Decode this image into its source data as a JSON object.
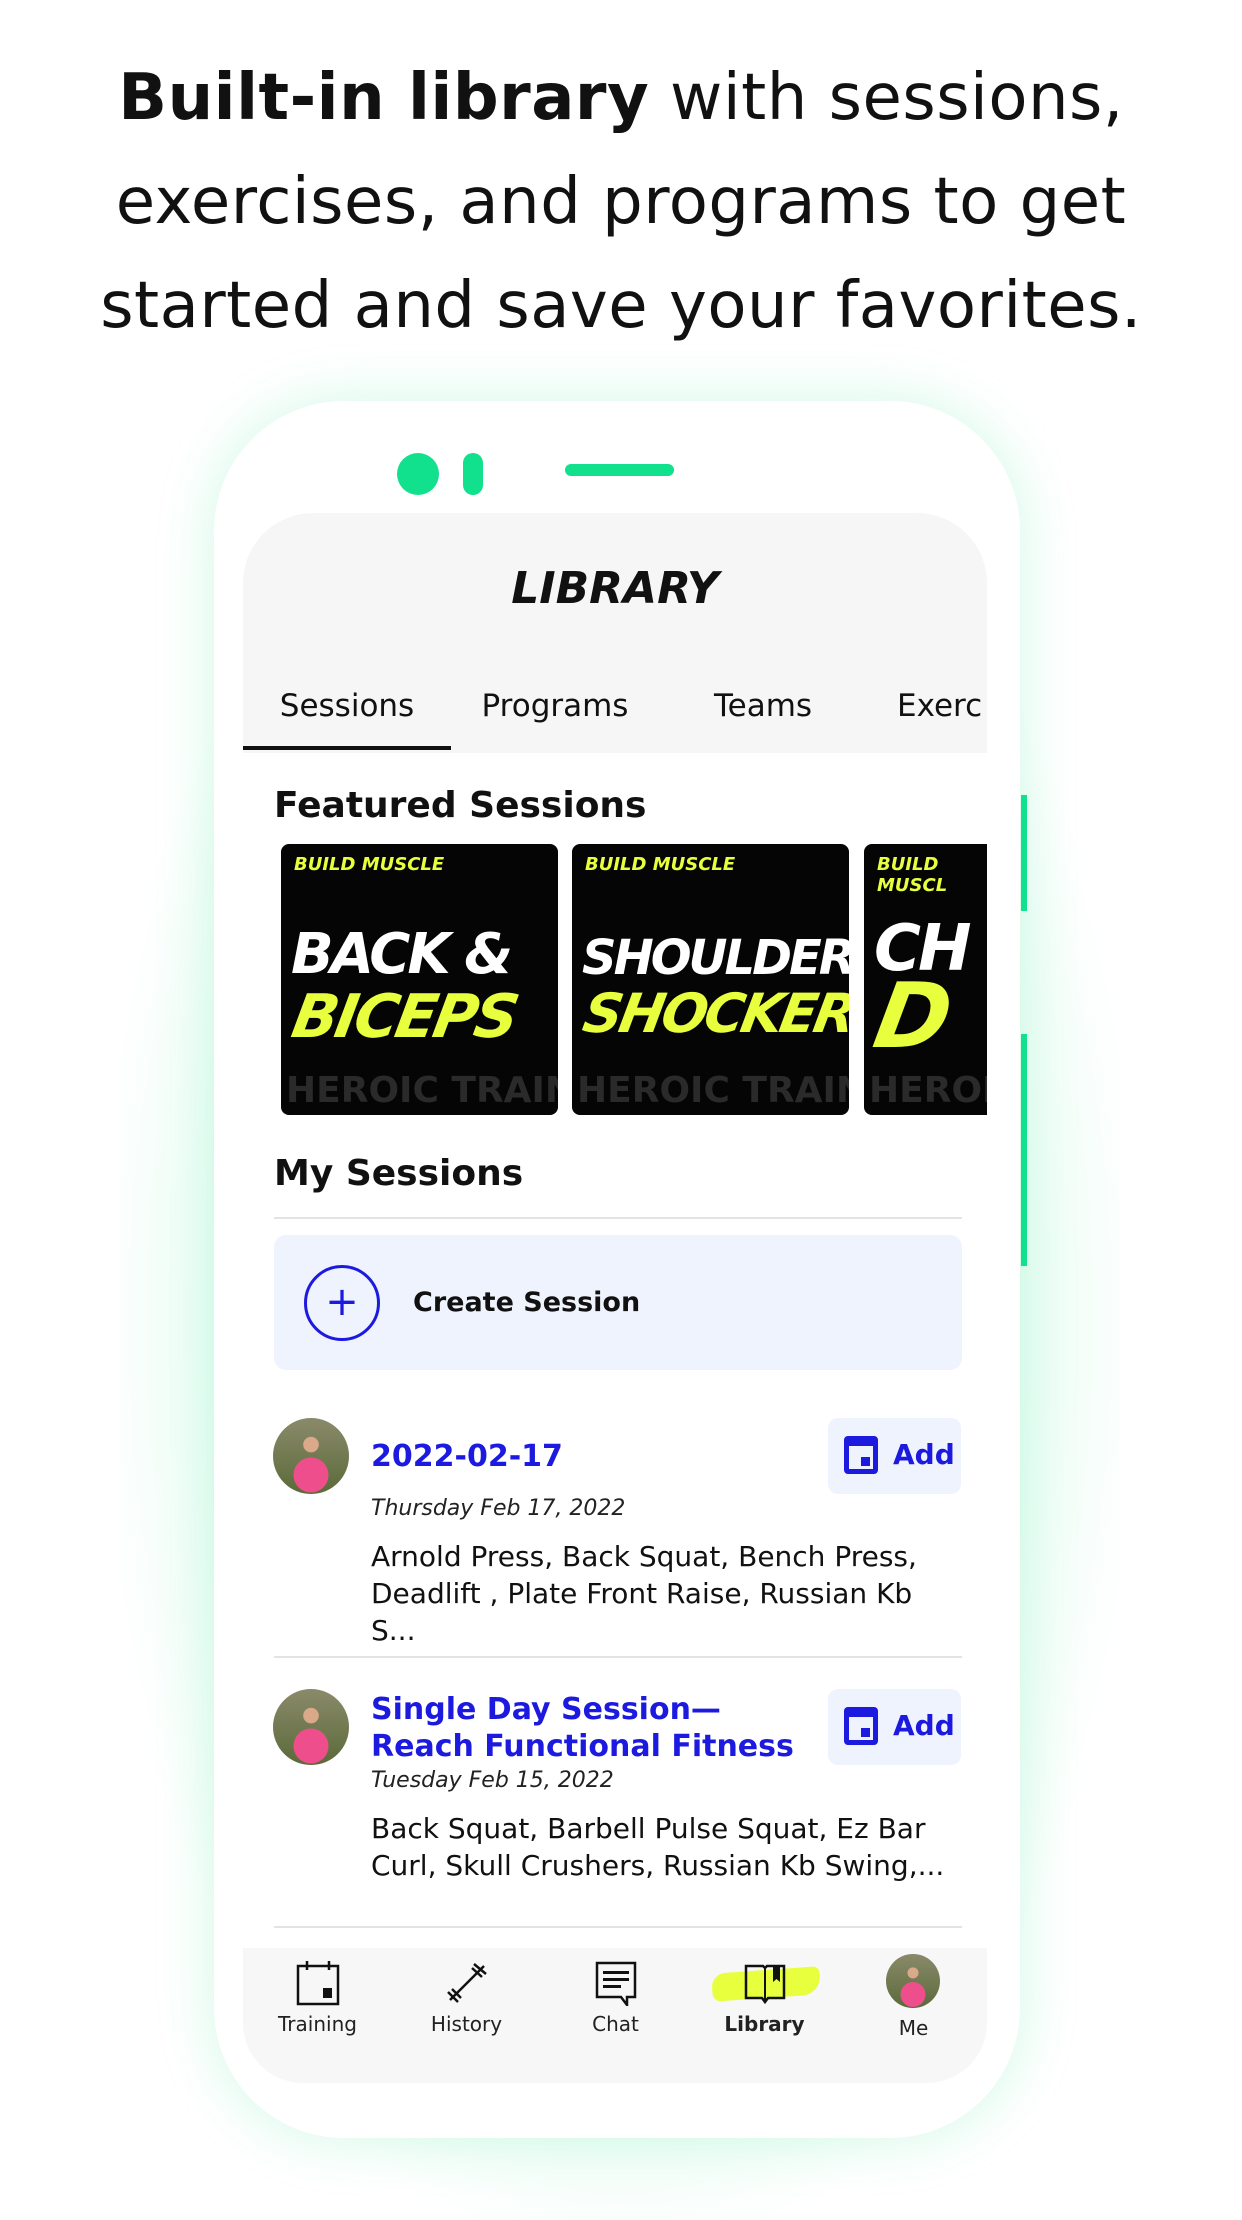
{
  "headline": {
    "bold": "Built-in library",
    "rest_line1": " with sessions,",
    "line2": "exercises, and programs to get",
    "line3": "started and save your favorites."
  },
  "colors": {
    "accent_green": "#11e08c",
    "link_blue": "#1d1ae0",
    "highlight_yellow": "#e8ff3d"
  },
  "screen": {
    "title": "LIBRARY"
  },
  "tabs": [
    {
      "label": "Sessions",
      "active": true
    },
    {
      "label": "Programs"
    },
    {
      "label": "Teams"
    },
    {
      "label": "Exerc"
    }
  ],
  "featured": {
    "heading": "Featured Sessions",
    "cards": [
      {
        "tag": "BUILD MUSCLE",
        "line1": "BACK &",
        "line2": "BICEPS",
        "watermark": "HEROIC TRAIN"
      },
      {
        "tag": "BUILD MUSCLE",
        "line1": "SHOULDER",
        "line2": "SHOCKER",
        "watermark": "HEROIC TRAIN"
      },
      {
        "tag": "BUILD MUSCL",
        "line1": "CH",
        "line2": "D",
        "watermark": "HEROIC"
      }
    ]
  },
  "my_sessions": {
    "heading": "My Sessions",
    "create_label": "Create Session",
    "create_icon": "plus-circle-icon",
    "items": [
      {
        "title": "2022-02-17",
        "date": "Thursday Feb 17, 2022",
        "exercises": "Arnold Press, Back Squat, Bench Press, Deadlift , Plate Front Raise, Russian Kb S...",
        "add_label": "Add"
      },
      {
        "title": "Single Day Session— Reach Functional Fitness",
        "date": "Tuesday Feb 15, 2022",
        "exercises": "Back Squat, Barbell Pulse Squat, Ez Bar Curl, Skull Crushers, Russian Kb Swing,...",
        "add_label": "Add"
      }
    ]
  },
  "nav": [
    {
      "label": "Training",
      "icon": "calendar-icon"
    },
    {
      "label": "History",
      "icon": "barbell-icon"
    },
    {
      "label": "Chat",
      "icon": "chat-icon"
    },
    {
      "label": "Library",
      "icon": "book-icon",
      "active": true
    },
    {
      "label": "Me",
      "icon": "avatar"
    }
  ]
}
